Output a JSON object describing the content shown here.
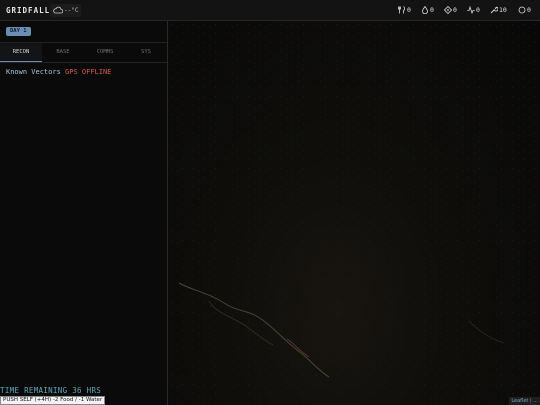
{
  "app": {
    "title": "GRIDFALL"
  },
  "weather": {
    "icon": "cloud-icon",
    "temperature": "--°C"
  },
  "stats": [
    {
      "name": "food",
      "icon": "fork-knife-icon",
      "value": "0"
    },
    {
      "name": "water",
      "icon": "droplet-icon",
      "value": "0"
    },
    {
      "name": "fuel",
      "icon": "target-icon",
      "value": "0"
    },
    {
      "name": "power",
      "icon": "pulse-icon",
      "value": "0"
    },
    {
      "name": "tools",
      "icon": "wrench-icon",
      "value": "10"
    },
    {
      "name": "morale",
      "icon": "circle-icon",
      "value": "0"
    }
  ],
  "panel": {
    "day_badge": "DAY 1",
    "tabs": [
      {
        "label": "RECON",
        "active": true
      },
      {
        "label": "BASE",
        "active": false
      },
      {
        "label": "COMMS",
        "active": false
      },
      {
        "label": "SYS",
        "active": false
      }
    ],
    "recon_label": "Known Vectors",
    "gps_status": "GPS OFFLINE",
    "time_remaining": "TIME REMAINING 36 HRS",
    "push_button": "PUSH SELF (+4H) -2 Food / -1 Water"
  },
  "map": {
    "attribution": "Leaflet | ..."
  },
  "colors": {
    "accent": "#6b8db4",
    "alert": "#d35a4a",
    "teal": "#5fa7b6"
  }
}
